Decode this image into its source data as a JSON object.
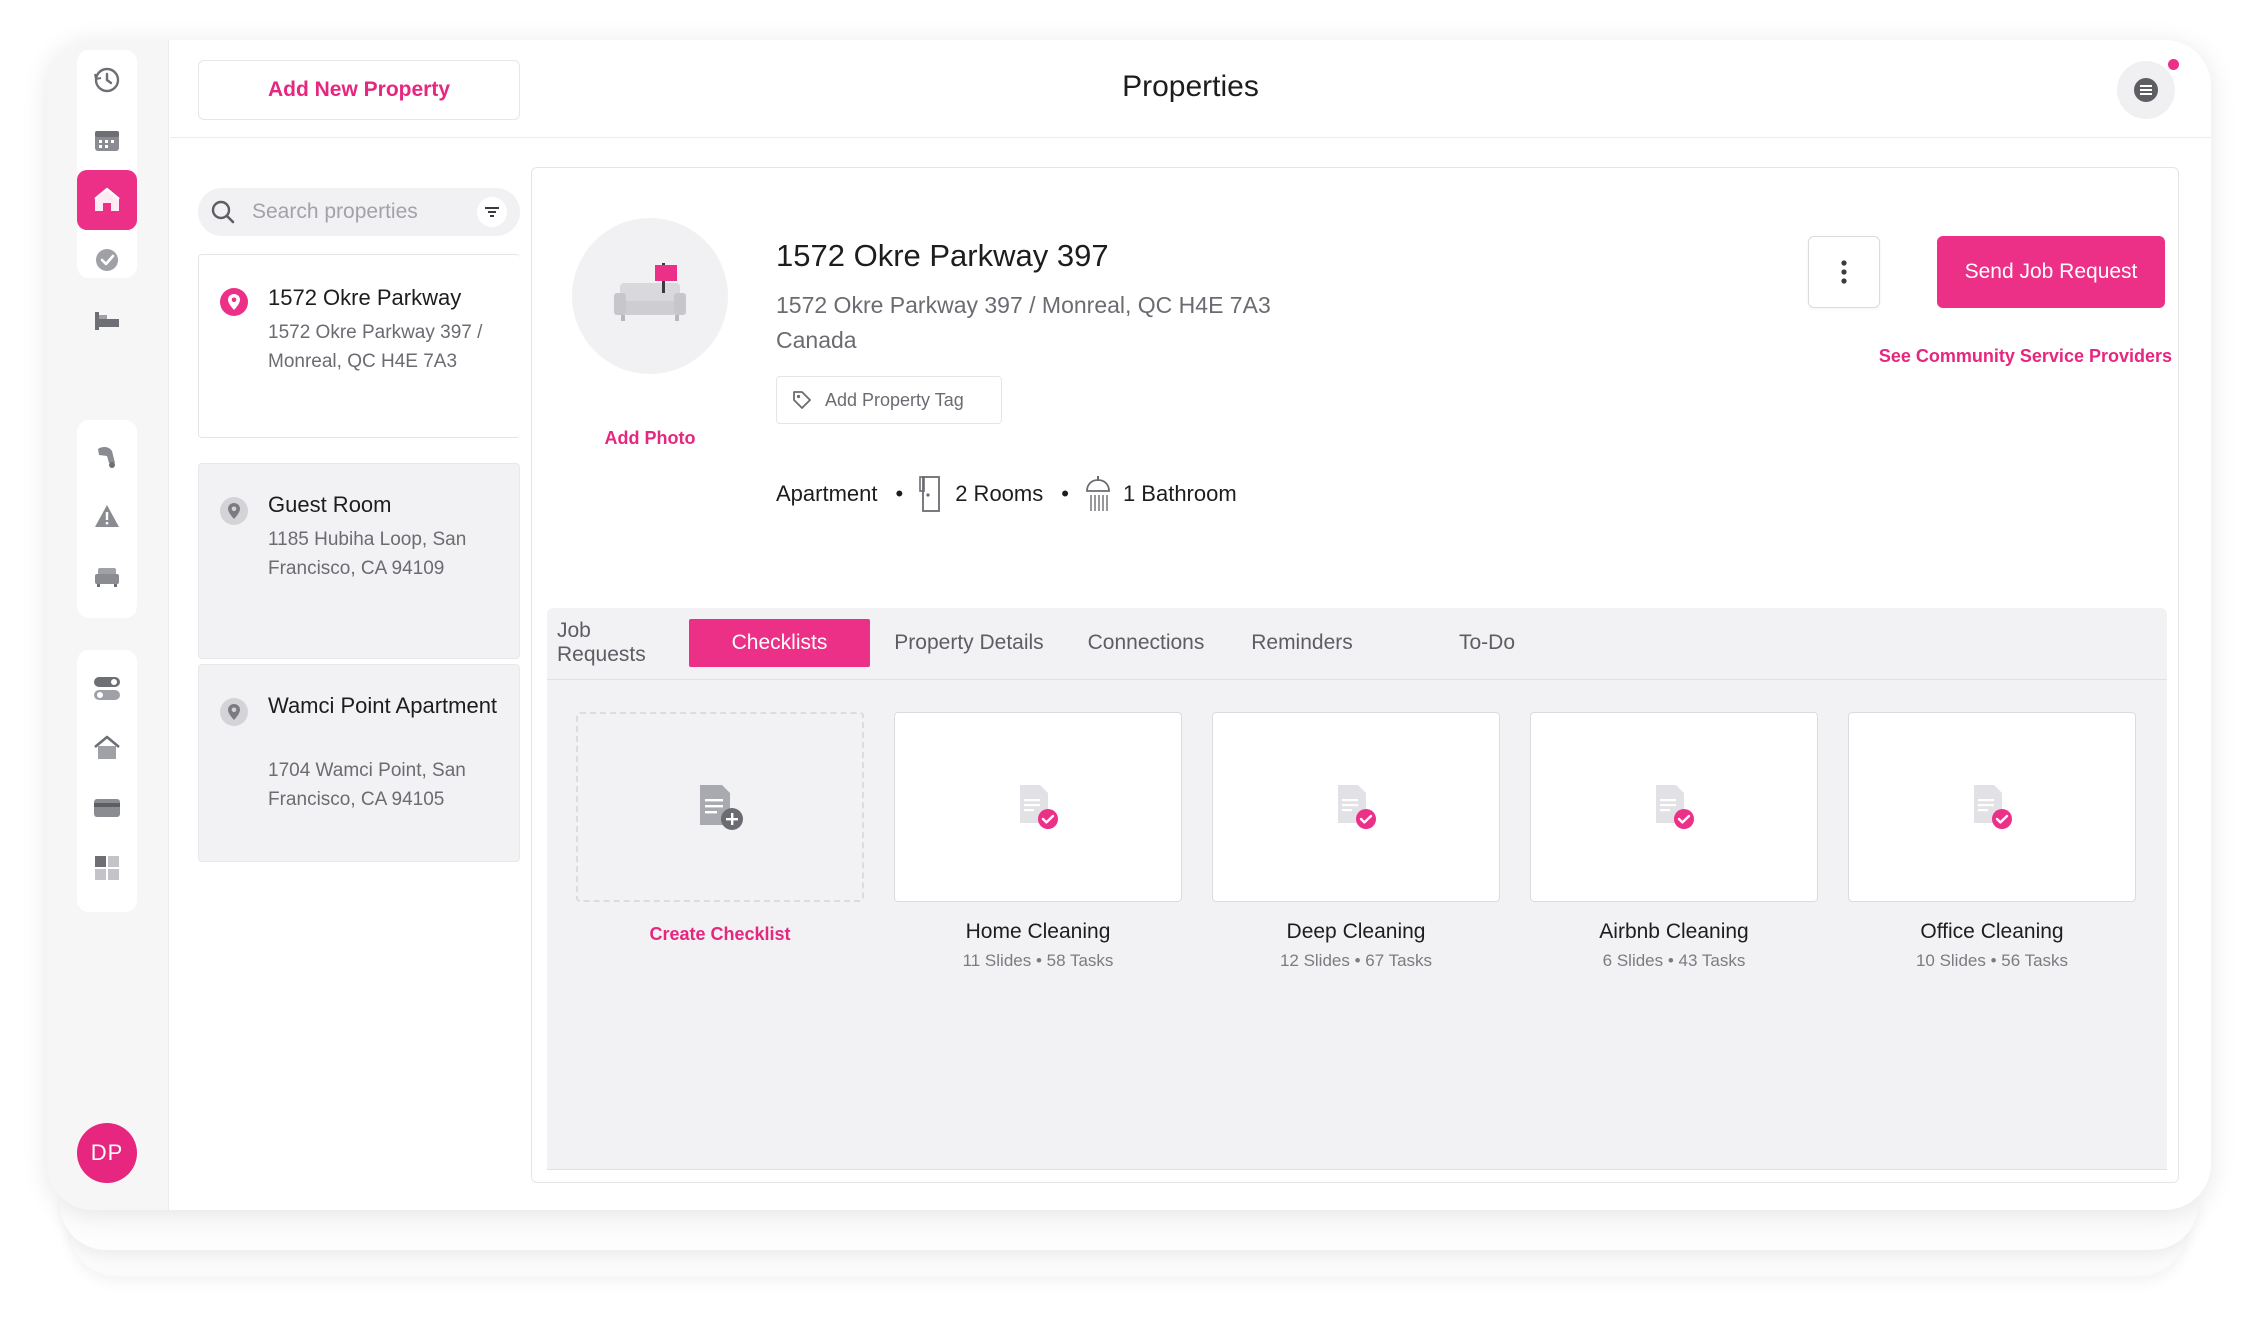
{
  "header": {
    "add_property_label": "Add New Property",
    "title": "Properties"
  },
  "search": {
    "placeholder": "Search properties"
  },
  "properties": [
    {
      "name": "1572 Okre Parkway",
      "address": "1572 Okre Parkway 397 / Monreal, QC H4E 7A3",
      "selected": true
    },
    {
      "name": "Guest Room",
      "address": "1185 Hubiha Loop, San Francisco, CA 94109",
      "selected": false
    },
    {
      "name": "Wamci Point Apartment",
      "address": "1704 Wamci Point, San Francisco, CA 94105",
      "selected": false
    }
  ],
  "detail": {
    "title": "1572 Okre Parkway 397",
    "address_line1": "1572 Okre Parkway 397 / Monreal, QC H4E 7A3",
    "address_line2": "Canada",
    "add_photo_label": "Add Photo",
    "add_tag_label": "Add Property Tag",
    "send_job_label": "Send Job Request",
    "community_label": "See Community Service Providers",
    "type": "Apartment",
    "rooms": "2 Rooms",
    "bathrooms": "1 Bathroom"
  },
  "tabs": [
    "Job Requests",
    "Checklists",
    "Property Details",
    "Connections",
    "Reminders",
    "To-Do"
  ],
  "active_tab": "Checklists",
  "checklists": {
    "create_label": "Create Checklist",
    "items": [
      {
        "name": "Home Cleaning",
        "stats": "11 Slides • 58 Tasks"
      },
      {
        "name": "Deep Cleaning",
        "stats": "12 Slides • 67 Tasks"
      },
      {
        "name": "Airbnb Cleaning",
        "stats": "6 Slides • 43 Tasks"
      },
      {
        "name": "Office Cleaning",
        "stats": "10 Slides • 56 Tasks"
      }
    ]
  },
  "user": {
    "initials": "DP"
  },
  "rail_icons": [
    "history-icon",
    "calendar-icon",
    "home-icon",
    "check-circle-icon",
    "bed-icon",
    "vacuum-icon",
    "warning-icon",
    "sofa-icon",
    "toggle-icon",
    "house-icon",
    "credit-card-icon",
    "dashboard-icon"
  ],
  "colors": {
    "accent": "#ec2f87",
    "panel": "#f2f2f4",
    "text": "#1d1d1f",
    "muted": "#6b6b72"
  }
}
